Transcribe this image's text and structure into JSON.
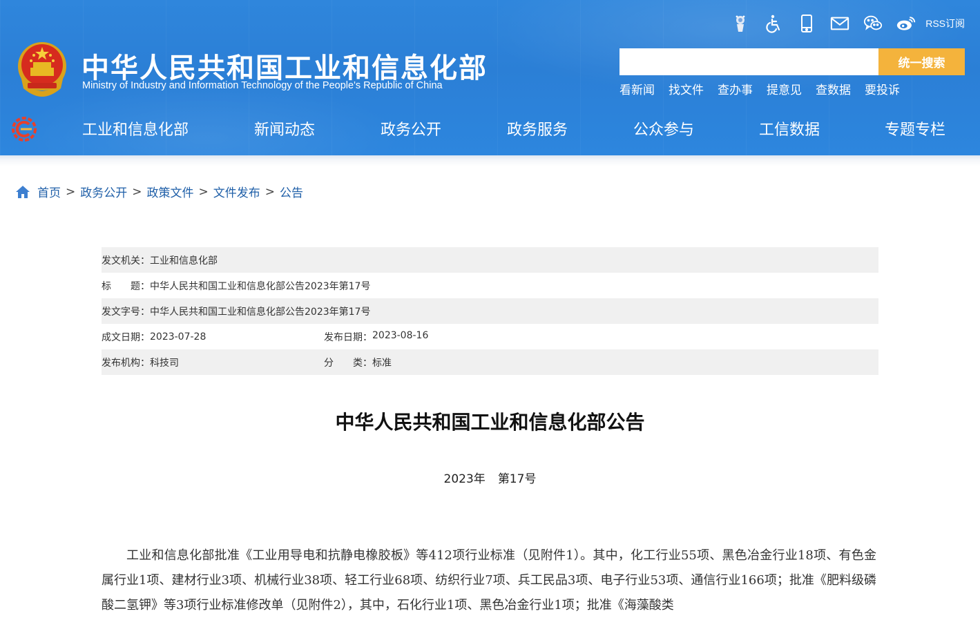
{
  "header": {
    "title": "中华人民共和国工业和信息化部",
    "subtitle": "Ministry of Industry and Information Technology of the People's Republic of China",
    "tools": [
      {
        "icon": "elder-mode-icon"
      },
      {
        "icon": "accessibility-icon"
      },
      {
        "icon": "mobile-icon"
      },
      {
        "icon": "mail-icon"
      },
      {
        "icon": "wechat-icon"
      },
      {
        "icon": "weibo-icon"
      }
    ],
    "rss_label": "RSS订阅",
    "search": {
      "placeholder": "",
      "button_label": "统一搜索"
    },
    "quick_links": [
      "看新闻",
      "找文件",
      "查办事",
      "提意见",
      "查数据",
      "要投诉"
    ],
    "nav": [
      "工业和信息化部",
      "新闻动态",
      "政务公开",
      "政务服务",
      "公众参与",
      "工信数据",
      "专题专栏"
    ]
  },
  "breadcrumb": [
    "首页",
    "政务公开",
    "政策文件",
    "文件发布",
    "公告"
  ],
  "meta": {
    "issuer": {
      "label": "发文机关：",
      "value": "工业和信息化部"
    },
    "title": {
      "label": "标　　题：",
      "value": "中华人民共和国工业和信息化部公告2023年第17号"
    },
    "doc_number": {
      "label": "发文字号：",
      "value": "中华人民共和国工业和信息化部公告2023年第17号"
    },
    "created": {
      "label": "成文日期：",
      "value": "2023-07-28"
    },
    "published": {
      "label": "发布日期：",
      "value": "2023-08-16"
    },
    "org": {
      "label": "发布机构：",
      "value": "科技司"
    },
    "category": {
      "label": "分　　类：",
      "value": "标准"
    }
  },
  "article": {
    "title": "中华人民共和国工业和信息化部公告",
    "year": "2023年",
    "number": "第17号",
    "body": "工业和信息化部批准《工业用导电和抗静电橡胶板》等412项行业标准（见附件1）。其中，化工行业55项、黑色冶金行业18项、有色金属行业1项、建材行业3项、机械行业38项、轻工行业68项、纺织行业7项、兵工民品3项、电子行业53项、通信行业166项；批准《肥料级磷酸二氢钾》等3项行业标准修改单（见附件2），其中，石化行业1项、黑色冶金行业1项；批准《海藻酸类"
  },
  "colors": {
    "header_blue": "#2b7fd6",
    "search_button": "#f4b33c",
    "link_blue": "#1f5fa8",
    "row_gray": "#f0f0f0"
  }
}
